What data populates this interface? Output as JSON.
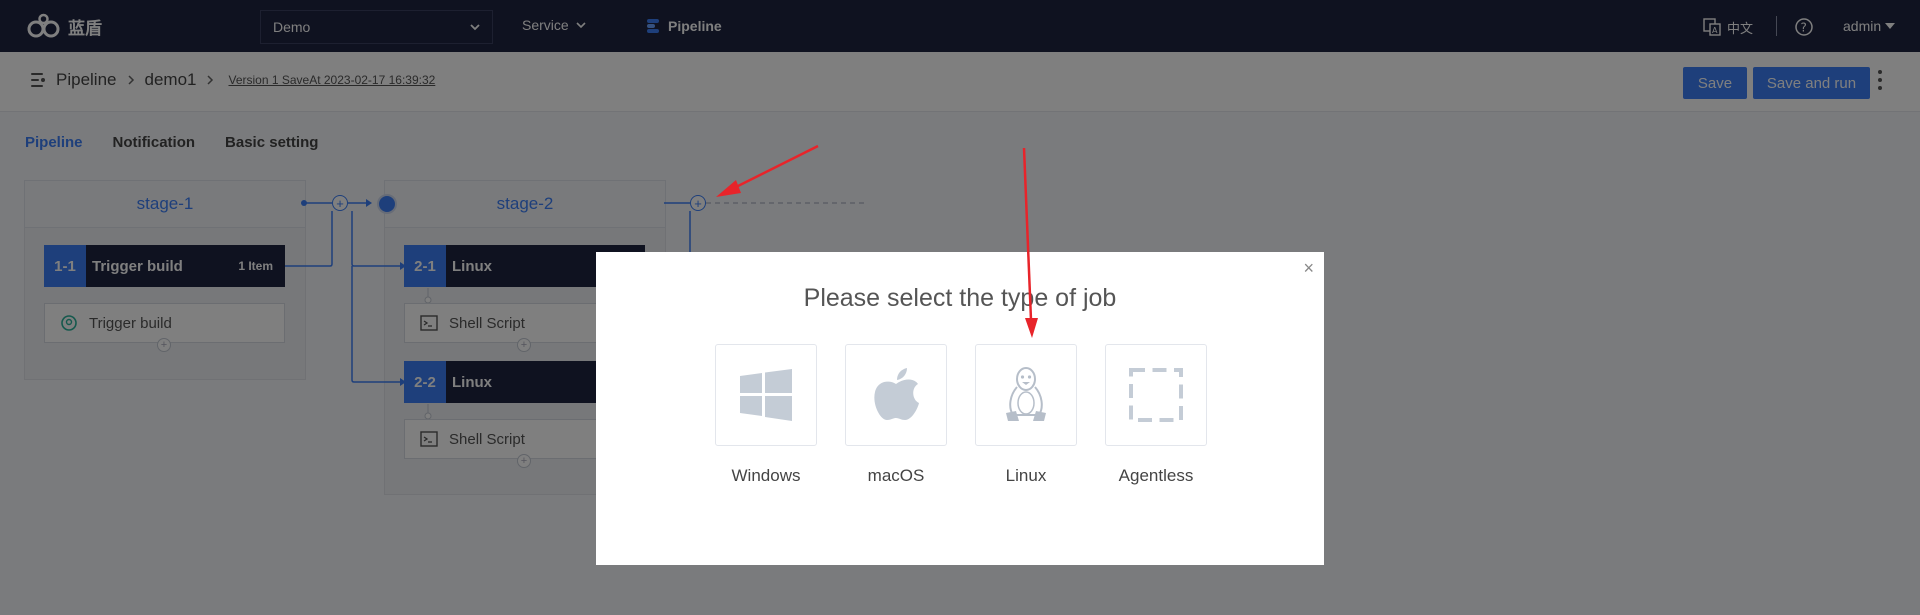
{
  "app": {
    "logo_text": "蓝盾"
  },
  "topnav": {
    "project": "Demo",
    "service": "Service",
    "pipeline": "Pipeline",
    "lang": "中文",
    "user": "admin"
  },
  "breadcrumb": {
    "root": "Pipeline",
    "name": "demo1",
    "version": "Version 1 SaveAt 2023-02-17 16:39:32"
  },
  "toolbar": {
    "save_label": "Save",
    "save_run_label": "Save and run"
  },
  "tabs": [
    {
      "label": "Pipeline",
      "active": true
    },
    {
      "label": "Notification",
      "active": false
    },
    {
      "label": "Basic setting",
      "active": false
    }
  ],
  "stages": [
    {
      "name": "stage-1",
      "jobs": [
        {
          "idx": "1-1",
          "title": "Trigger build",
          "count": "1 Item",
          "task": "Trigger build"
        }
      ]
    },
    {
      "name": "stage-2",
      "jobs": [
        {
          "idx": "2-1",
          "title": "Linux",
          "task": "Shell Script"
        },
        {
          "idx": "2-2",
          "title": "Linux",
          "task": "Shell Script"
        }
      ]
    }
  ],
  "modal": {
    "title": "Please select the type of job",
    "close": "×",
    "options": [
      {
        "label": "Windows",
        "icon": "windows-icon"
      },
      {
        "label": "macOS",
        "icon": "apple-icon"
      },
      {
        "label": "Linux",
        "icon": "linux-icon"
      },
      {
        "label": "Agentless",
        "icon": "agentless-icon"
      }
    ]
  },
  "colors": {
    "nav_bg": "#1e2440",
    "accent": "#3c7ff6",
    "annotation": "#e8242a"
  }
}
